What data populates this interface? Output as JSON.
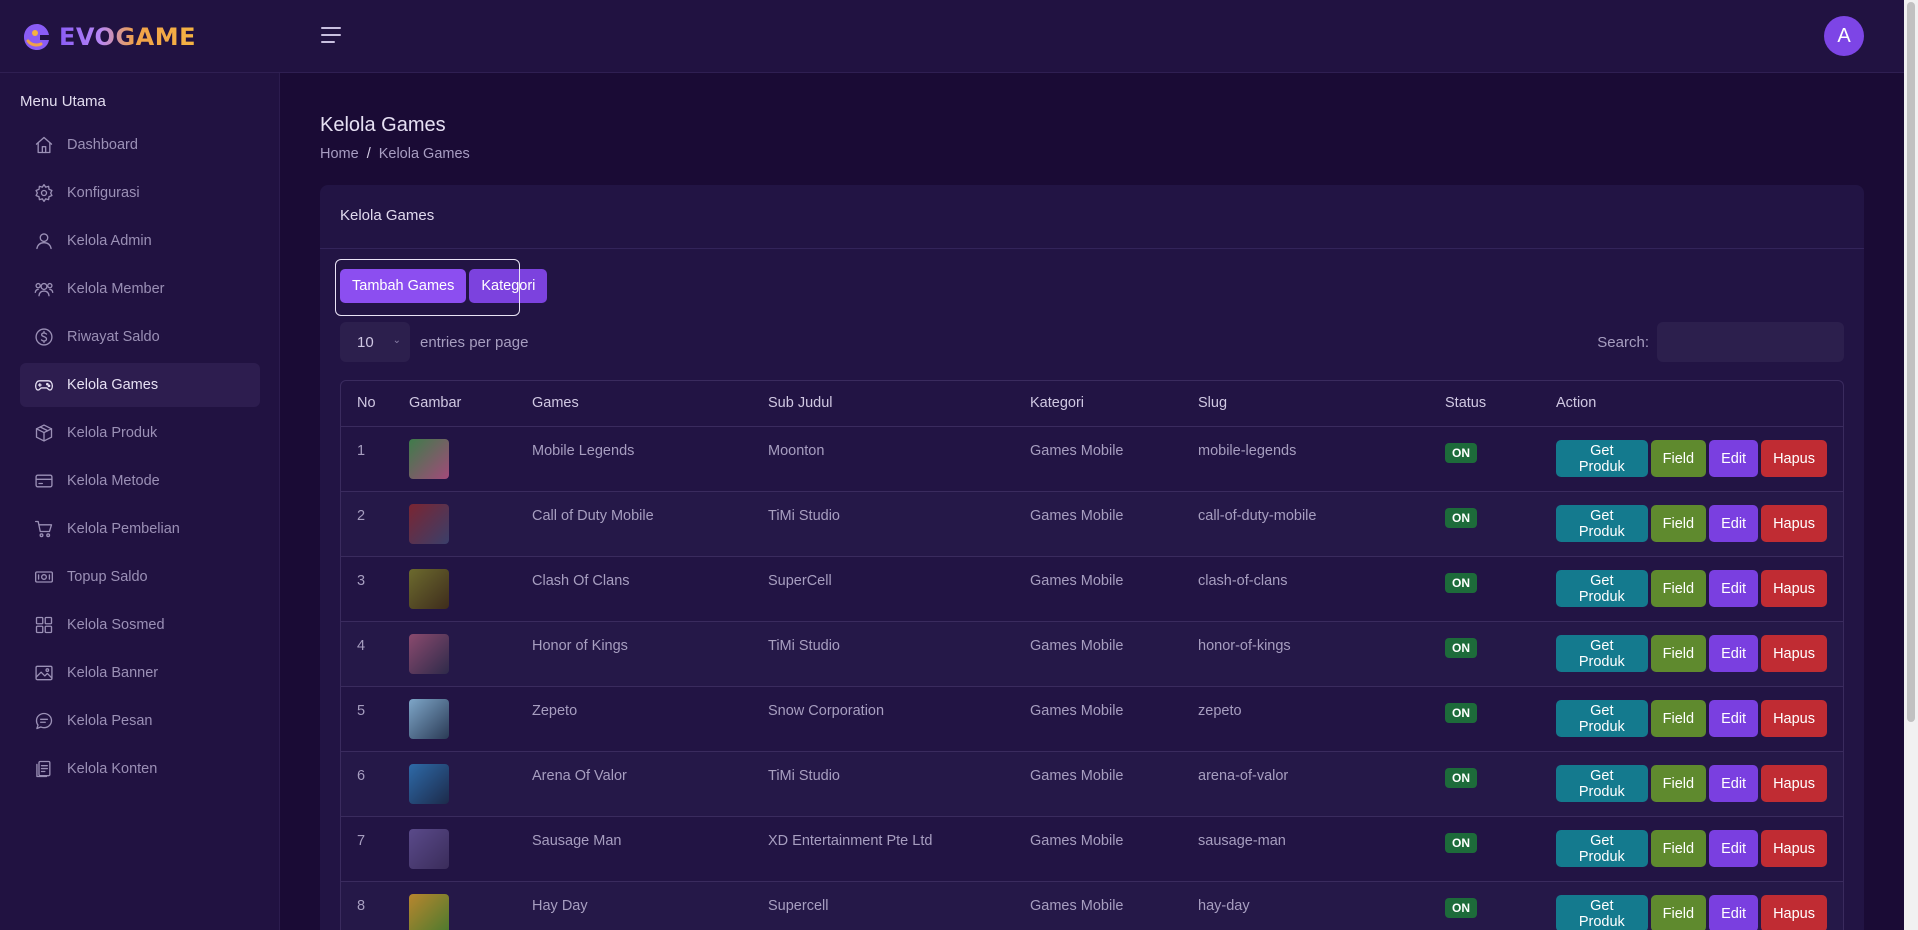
{
  "brand": {
    "name": "EVOGAME"
  },
  "user": {
    "avatar_initial": "A"
  },
  "sidebar": {
    "title": "Menu Utama",
    "items": [
      {
        "label": "Dashboard",
        "icon": "home-icon"
      },
      {
        "label": "Konfigurasi",
        "icon": "gear-icon"
      },
      {
        "label": "Kelola Admin",
        "icon": "user-icon"
      },
      {
        "label": "Kelola Member",
        "icon": "users-icon"
      },
      {
        "label": "Riwayat Saldo",
        "icon": "dollar-circle-icon"
      },
      {
        "label": "Kelola Games",
        "icon": "gamepad-icon",
        "active": true
      },
      {
        "label": "Kelola Produk",
        "icon": "box-icon"
      },
      {
        "label": "Kelola Metode",
        "icon": "credit-card-icon"
      },
      {
        "label": "Kelola Pembelian",
        "icon": "cart-icon"
      },
      {
        "label": "Topup Saldo",
        "icon": "money-icon"
      },
      {
        "label": "Kelola Sosmed",
        "icon": "grid-icon"
      },
      {
        "label": "Kelola Banner",
        "icon": "image-icon"
      },
      {
        "label": "Kelola Pesan",
        "icon": "chat-icon"
      },
      {
        "label": "Kelola Konten",
        "icon": "document-icon"
      }
    ]
  },
  "page": {
    "title": "Kelola Games",
    "breadcrumb": {
      "home": "Home",
      "sep": "/",
      "current": "Kelola Games"
    }
  },
  "card": {
    "title": "Kelola Games",
    "add_button": "Tambah Games",
    "category_button": "Kategori",
    "entries_value": "10",
    "entries_label": "entries per page",
    "search_label": "Search:",
    "search_value": ""
  },
  "table": {
    "columns": [
      "No",
      "Gambar",
      "Games",
      "Sub Judul",
      "Kategori",
      "Slug",
      "Status",
      "Action"
    ],
    "action_labels": {
      "get": "Get Produk",
      "field": "Field",
      "edit": "Edit",
      "delete": "Hapus"
    },
    "rows": [
      {
        "no": "1",
        "game": "Mobile Legends",
        "sub": "Moonton",
        "kategori": "Games Mobile",
        "slug": "mobile-legends",
        "status": "ON",
        "thumb_colors": [
          "#3e7c4a",
          "#a24a7a"
        ]
      },
      {
        "no": "2",
        "game": "Call of Duty Mobile",
        "sub": "TiMi Studio",
        "kategori": "Games Mobile",
        "slug": "call-of-duty-mobile",
        "status": "ON",
        "thumb_colors": [
          "#7a2532",
          "#3a3f6a"
        ]
      },
      {
        "no": "3",
        "game": "Clash Of Clans",
        "sub": "SuperCell",
        "kategori": "Games Mobile",
        "slug": "clash-of-clans",
        "status": "ON",
        "thumb_colors": [
          "#6c6a2e",
          "#3e2c1c"
        ]
      },
      {
        "no": "4",
        "game": "Honor of Kings",
        "sub": "TiMi Studio",
        "kategori": "Games Mobile",
        "slug": "honor-of-kings",
        "status": "ON",
        "thumb_colors": [
          "#8a4a6e",
          "#2e2a4a"
        ]
      },
      {
        "no": "5",
        "game": "Zepeto",
        "sub": "Snow Corporation",
        "kategori": "Games Mobile",
        "slug": "zepeto",
        "status": "ON",
        "thumb_colors": [
          "#7ea6c8",
          "#2a3a55"
        ]
      },
      {
        "no": "6",
        "game": "Arena Of Valor",
        "sub": "TiMi Studio",
        "kategori": "Games Mobile",
        "slug": "arena-of-valor",
        "status": "ON",
        "thumb_colors": [
          "#2e6aa8",
          "#1c2a4a"
        ]
      },
      {
        "no": "7",
        "game": "Sausage Man",
        "sub": "XD Entertainment Pte Ltd",
        "kategori": "Games Mobile",
        "slug": "sausage-man",
        "status": "ON",
        "thumb_colors": [
          "#5a4a8a",
          "#3a2c5a"
        ]
      },
      {
        "no": "8",
        "game": "Hay Day",
        "sub": "Supercell",
        "kategori": "Games Mobile",
        "slug": "hay-day",
        "status": "ON",
        "thumb_colors": [
          "#b8862e",
          "#4a7a2e"
        ]
      }
    ]
  }
}
